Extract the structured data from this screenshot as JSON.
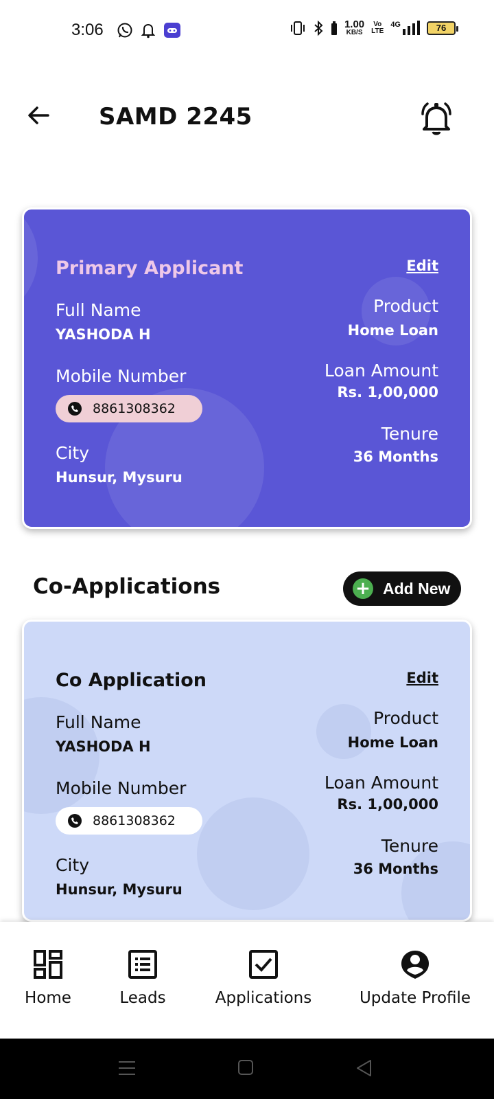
{
  "status_bar": {
    "time": "3:06",
    "speed_value": "1.00",
    "speed_unit": "KB/S",
    "volte_top": "Vo",
    "volte_bottom": "LTE",
    "network": "4G",
    "battery": "76"
  },
  "header": {
    "title": "SAMD 2245"
  },
  "primary_card": {
    "title": "Primary Applicant",
    "edit_label": "Edit",
    "full_name_label": "Full Name",
    "full_name": "YASHODA H",
    "mobile_label": "Mobile Number",
    "mobile": "8861308362",
    "city_label": "City",
    "city": "Hunsur, Mysuru",
    "product_label": "Product",
    "product": "Home Loan",
    "loan_amount_label": "Loan Amount",
    "loan_amount": "Rs. 1,00,000",
    "tenure_label": "Tenure",
    "tenure": "36 Months"
  },
  "co_section": {
    "title": "Co-Applications",
    "add_new_label": "Add New"
  },
  "co_card": {
    "title": "Co Application",
    "edit_label": "Edit",
    "full_name_label": "Full Name",
    "full_name": "YASHODA H",
    "mobile_label": "Mobile Number",
    "mobile": "8861308362",
    "city_label": "City",
    "city": "Hunsur, Mysuru",
    "product_label": "Product",
    "product": "Home Loan",
    "loan_amount_label": "Loan Amount",
    "loan_amount": "Rs. 1,00,000",
    "tenure_label": "Tenure",
    "tenure": "36 Months"
  },
  "bottom_nav": {
    "items": [
      {
        "label": "Home",
        "icon": "dashboard-icon"
      },
      {
        "label": "Leads",
        "icon": "list-icon"
      },
      {
        "label": "Applications",
        "icon": "checkbox-icon"
      },
      {
        "label": "Update Profile",
        "icon": "profile-pin-icon"
      }
    ]
  },
  "colors": {
    "primary_card_bg": "#5a56d6",
    "co_card_bg": "#cdd9f8",
    "accent_green": "#4caf50"
  }
}
